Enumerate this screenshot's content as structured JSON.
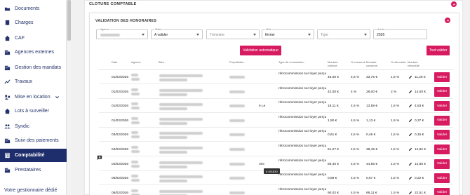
{
  "sidebar": {
    "items": [
      {
        "label": "Documents",
        "icon": "folder-icon"
      },
      {
        "label": "Charges",
        "icon": "receipt-icon"
      },
      {
        "label": "CAF",
        "icon": "home-icon"
      },
      {
        "label": "Agences externes",
        "icon": "building-icon"
      },
      {
        "label": "Gestion des mandats",
        "icon": "building-icon"
      },
      {
        "label": "Travaux",
        "icon": "chart-line-icon"
      },
      {
        "label": "Mise en location",
        "icon": "key-icon"
      },
      {
        "label": "Lots à surveiller",
        "icon": "home-icon"
      },
      {
        "label": "Syndic",
        "icon": "people-icon"
      },
      {
        "label": "Suivi des paiements",
        "icon": "building-icon"
      },
      {
        "label": "Comptabilité",
        "icon": "calculator-icon"
      },
      {
        "label": "Prestataires",
        "icon": "building-icon"
      }
    ],
    "active_index": 10,
    "footer": "Votre gestionnaire dédié",
    "active_bg": "#1e2d6b",
    "text_color": "#24336b"
  },
  "outer": {
    "title": "CLOTURE COMPTABLE"
  },
  "inner": {
    "title": "VALIDATION DES HONORAIRES"
  },
  "filters": {
    "agence": {
      "label": "Agence",
      "value": ""
    },
    "statut": {
      "label": "Statut",
      "value": "A valider"
    },
    "trimestre": {
      "placeholder": "Trimestre"
    },
    "mois": {
      "label": "Mois",
      "value": "février"
    },
    "type": {
      "placeholder": "Type"
    },
    "annee": {
      "label": "Année",
      "value": "2026"
    }
  },
  "buttons": {
    "validation_auto": "Validation automatique",
    "tout_valider": "Tout valider"
  },
  "table": {
    "headers": [
      "Date",
      "Agence",
      "Bien",
      "Propriétaire",
      "Type de commission",
      "Montant collecté",
      "% conservé",
      "Montant conservé",
      "% rétrocédé",
      "Montant rétrocédé"
    ],
    "action_label": "Valider",
    "commission_type": "rétrocommission sur loyer perçu",
    "rows": [
      {
        "date": "01/02/2026",
        "collecte": "45,00 €",
        "pct_conserve": "4,5 %",
        "conserve": "33,75 €",
        "pct_retro": "1,5 %",
        "retro": "11,25 €"
      },
      {
        "date": "01/02/2026",
        "collecte": "42,00 €",
        "pct_conserve": "4 %",
        "conserve": "28,00 €",
        "pct_retro": "2 %",
        "retro": "14,00 €"
      },
      {
        "date": "01/02/2026",
        "collecte": "18,11 €",
        "pct_conserve": "4,5 %",
        "conserve": "13,58 €",
        "pct_retro": "1,5 %",
        "retro": "4,53 €",
        "owner_suffix": "é Le"
      },
      {
        "date": "01/02/2026",
        "collecte": "1,50 €",
        "pct_conserve": "4,5 %",
        "conserve": "1,13 €",
        "pct_retro": "1,5 %",
        "retro": "0,37 €"
      },
      {
        "date": "03/02/2026",
        "collecte": "0,61 €",
        "pct_conserve": "4,5 %",
        "conserve": "0,46 €",
        "pct_retro": "1,5 %",
        "retro": "0,15 €"
      },
      {
        "date": "04/02/2026",
        "collecte": "51,27 €",
        "pct_conserve": "4,5 %",
        "conserve": "38,45 €",
        "pct_retro": "1,5 %",
        "retro": "12,82 €"
      },
      {
        "date": "04/02/2026",
        "collecte": "59,40 €",
        "pct_conserve": "4,5 %",
        "conserve": "44,55 €",
        "pct_retro": "1,5 %",
        "retro": "14,85 €",
        "owner_suffix": "orie"
      },
      {
        "date": "06/02/2026",
        "collecte": "0,89 €",
        "pct_conserve": "4,5 %",
        "conserve": "0,67 €",
        "pct_retro": "1,5 %",
        "retro": "0,22 €"
      },
      {
        "date": "06/02/2026",
        "collecte": "90,02 €",
        "pct_conserve": "4,5 %",
        "conserve": "68,11 €",
        "pct_retro": "1,5 %",
        "retro": "22,51 €"
      }
    ]
  },
  "tooltip": "# 451830",
  "accent": "#d81b60"
}
